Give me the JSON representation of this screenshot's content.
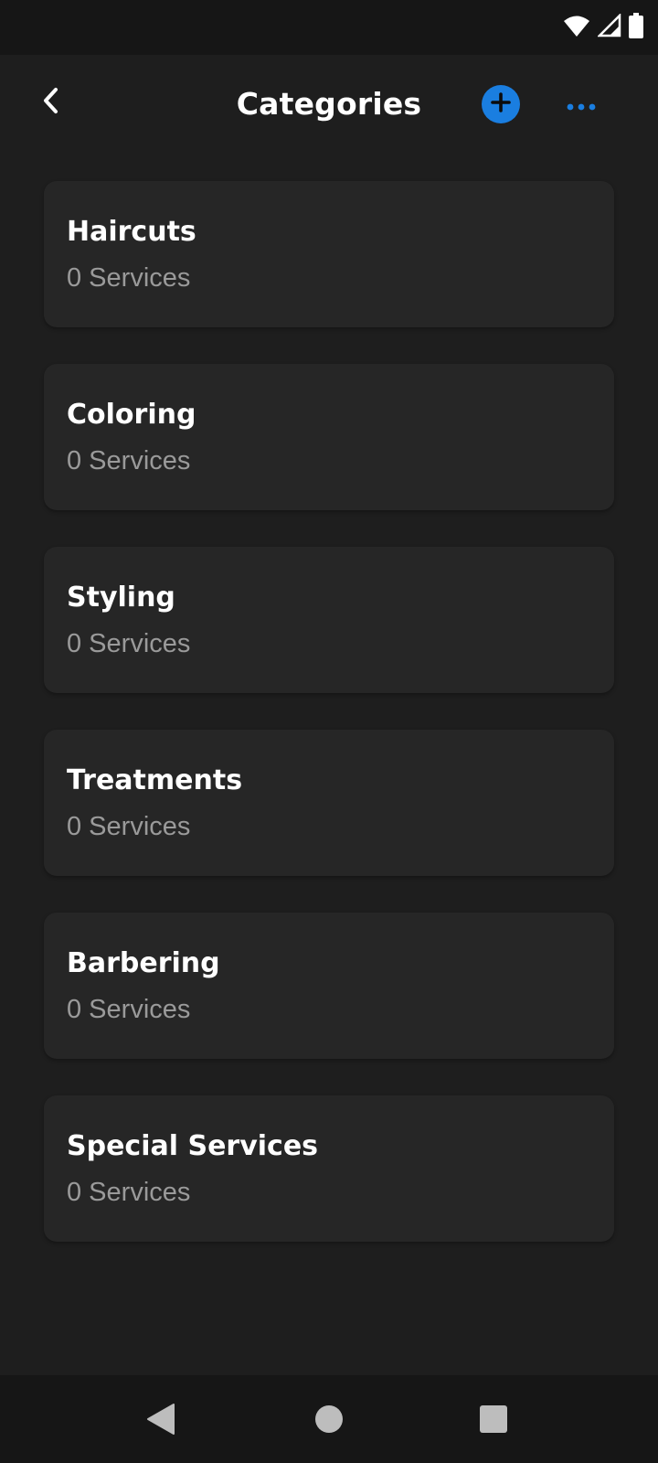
{
  "header": {
    "title": "Categories",
    "back_icon": "chevron-left-icon",
    "add_icon": "plus-circle-icon",
    "more_icon": "ellipsis-icon",
    "accent_color": "#1a7ee0"
  },
  "status_bar": {
    "icons": [
      "wifi-icon",
      "signal-icon",
      "battery-icon"
    ]
  },
  "categories": [
    {
      "name": "Haircuts",
      "count": "0 Services"
    },
    {
      "name": "Coloring",
      "count": "0 Services"
    },
    {
      "name": "Styling",
      "count": "0 Services"
    },
    {
      "name": "Treatments",
      "count": "0 Services"
    },
    {
      "name": "Barbering",
      "count": "0 Services"
    },
    {
      "name": "Special Services",
      "count": "0 Services"
    }
  ],
  "nav_bar": {
    "icons": [
      "nav-back-icon",
      "nav-home-icon",
      "nav-recents-icon"
    ]
  }
}
